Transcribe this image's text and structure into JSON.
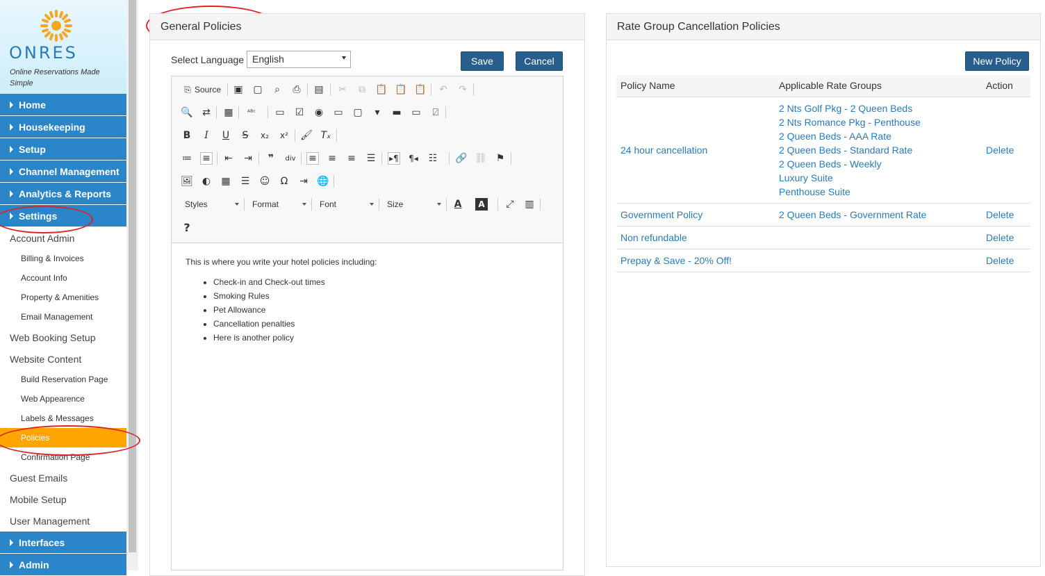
{
  "brand": {
    "logo": "ONRES",
    "tagline": "Online Reservations Made Simple"
  },
  "sidebar": {
    "main_top": [
      "Home",
      "Housekeeping",
      "Setup",
      "Channel Management",
      "Analytics & Reports",
      "Settings"
    ],
    "sub": [
      {
        "label": "Account Admin",
        "level": 1
      },
      {
        "label": "Billing & Invoices",
        "level": 2
      },
      {
        "label": "Account Info",
        "level": 2
      },
      {
        "label": "Property & Amenities",
        "level": 2
      },
      {
        "label": "Email Management",
        "level": 2
      },
      {
        "label": "Web Booking Setup",
        "level": 1
      },
      {
        "label": "Website Content",
        "level": 1
      },
      {
        "label": "Build Reservation Page",
        "level": 2
      },
      {
        "label": "Web Appearence",
        "level": 2
      },
      {
        "label": "Labels & Messages",
        "level": 2
      },
      {
        "label": "Policies",
        "level": 2,
        "active": true
      },
      {
        "label": "Confirmation Page",
        "level": 2
      },
      {
        "label": "Guest Emails",
        "level": 1
      },
      {
        "label": "Mobile Setup",
        "level": 1
      },
      {
        "label": "User Management",
        "level": 1
      }
    ],
    "main_bottom": [
      "Interfaces",
      "Admin"
    ]
  },
  "general": {
    "title": "General Policies",
    "select_language_label": "Select Language",
    "language": "English",
    "save": "Save",
    "cancel": "Cancel"
  },
  "toolbar": {
    "source": "Source",
    "styles": "Styles",
    "format": "Format",
    "font": "Font",
    "size": "Size",
    "help": "?"
  },
  "editor": {
    "intro": "This is where you write your hotel policies including:",
    "items": [
      "Check-in and Check-out times",
      "Smoking Rules",
      "Pet Allowance",
      "Cancellation penalties",
      "Here is another policy"
    ]
  },
  "rate": {
    "title": "Rate Group Cancellation Policies",
    "new_policy": "New Policy",
    "headers": [
      "Policy Name",
      "Applicable Rate Groups",
      "Action"
    ],
    "rows": [
      {
        "name": "24 hour cancellation",
        "groups": [
          "2 Nts Golf Pkg - 2 Queen Beds",
          "2 Nts Romance Pkg - Penthouse",
          "2 Queen Beds - AAA Rate",
          "2 Queen Beds - Standard Rate",
          "2 Queen Beds - Weekly",
          "Luxury Suite",
          "Penthouse Suite"
        ],
        "action": "Delete"
      },
      {
        "name": "Government Policy",
        "groups": [
          "2 Queen Beds - Government Rate"
        ],
        "action": "Delete"
      },
      {
        "name": "Non refundable",
        "groups": [],
        "action": "Delete"
      },
      {
        "name": "Prepay & Save - 20% Off!",
        "groups": [],
        "action": "Delete"
      }
    ]
  },
  "colors": {
    "nav": "#2a86c8",
    "active": "#ffa500",
    "button": "#285e8e",
    "link": "#2a7ab8",
    "annotation": "#d9242a"
  }
}
